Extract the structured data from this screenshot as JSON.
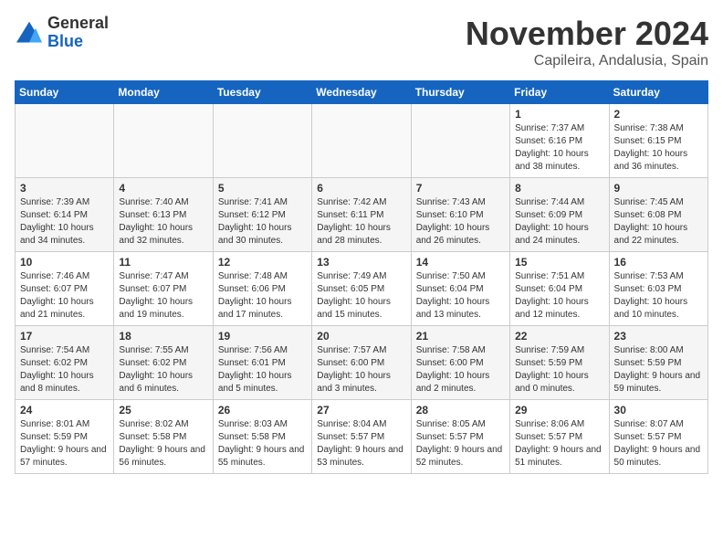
{
  "logo": {
    "general": "General",
    "blue": "Blue"
  },
  "title": "November 2024",
  "location": "Capileira, Andalusia, Spain",
  "days_of_week": [
    "Sunday",
    "Monday",
    "Tuesday",
    "Wednesday",
    "Thursday",
    "Friday",
    "Saturday"
  ],
  "weeks": [
    [
      {
        "day": "",
        "info": ""
      },
      {
        "day": "",
        "info": ""
      },
      {
        "day": "",
        "info": ""
      },
      {
        "day": "",
        "info": ""
      },
      {
        "day": "",
        "info": ""
      },
      {
        "day": "1",
        "info": "Sunrise: 7:37 AM\nSunset: 6:16 PM\nDaylight: 10 hours and 38 minutes."
      },
      {
        "day": "2",
        "info": "Sunrise: 7:38 AM\nSunset: 6:15 PM\nDaylight: 10 hours and 36 minutes."
      }
    ],
    [
      {
        "day": "3",
        "info": "Sunrise: 7:39 AM\nSunset: 6:14 PM\nDaylight: 10 hours and 34 minutes."
      },
      {
        "day": "4",
        "info": "Sunrise: 7:40 AM\nSunset: 6:13 PM\nDaylight: 10 hours and 32 minutes."
      },
      {
        "day": "5",
        "info": "Sunrise: 7:41 AM\nSunset: 6:12 PM\nDaylight: 10 hours and 30 minutes."
      },
      {
        "day": "6",
        "info": "Sunrise: 7:42 AM\nSunset: 6:11 PM\nDaylight: 10 hours and 28 minutes."
      },
      {
        "day": "7",
        "info": "Sunrise: 7:43 AM\nSunset: 6:10 PM\nDaylight: 10 hours and 26 minutes."
      },
      {
        "day": "8",
        "info": "Sunrise: 7:44 AM\nSunset: 6:09 PM\nDaylight: 10 hours and 24 minutes."
      },
      {
        "day": "9",
        "info": "Sunrise: 7:45 AM\nSunset: 6:08 PM\nDaylight: 10 hours and 22 minutes."
      }
    ],
    [
      {
        "day": "10",
        "info": "Sunrise: 7:46 AM\nSunset: 6:07 PM\nDaylight: 10 hours and 21 minutes."
      },
      {
        "day": "11",
        "info": "Sunrise: 7:47 AM\nSunset: 6:07 PM\nDaylight: 10 hours and 19 minutes."
      },
      {
        "day": "12",
        "info": "Sunrise: 7:48 AM\nSunset: 6:06 PM\nDaylight: 10 hours and 17 minutes."
      },
      {
        "day": "13",
        "info": "Sunrise: 7:49 AM\nSunset: 6:05 PM\nDaylight: 10 hours and 15 minutes."
      },
      {
        "day": "14",
        "info": "Sunrise: 7:50 AM\nSunset: 6:04 PM\nDaylight: 10 hours and 13 minutes."
      },
      {
        "day": "15",
        "info": "Sunrise: 7:51 AM\nSunset: 6:04 PM\nDaylight: 10 hours and 12 minutes."
      },
      {
        "day": "16",
        "info": "Sunrise: 7:53 AM\nSunset: 6:03 PM\nDaylight: 10 hours and 10 minutes."
      }
    ],
    [
      {
        "day": "17",
        "info": "Sunrise: 7:54 AM\nSunset: 6:02 PM\nDaylight: 10 hours and 8 minutes."
      },
      {
        "day": "18",
        "info": "Sunrise: 7:55 AM\nSunset: 6:02 PM\nDaylight: 10 hours and 6 minutes."
      },
      {
        "day": "19",
        "info": "Sunrise: 7:56 AM\nSunset: 6:01 PM\nDaylight: 10 hours and 5 minutes."
      },
      {
        "day": "20",
        "info": "Sunrise: 7:57 AM\nSunset: 6:00 PM\nDaylight: 10 hours and 3 minutes."
      },
      {
        "day": "21",
        "info": "Sunrise: 7:58 AM\nSunset: 6:00 PM\nDaylight: 10 hours and 2 minutes."
      },
      {
        "day": "22",
        "info": "Sunrise: 7:59 AM\nSunset: 5:59 PM\nDaylight: 10 hours and 0 minutes."
      },
      {
        "day": "23",
        "info": "Sunrise: 8:00 AM\nSunset: 5:59 PM\nDaylight: 9 hours and 59 minutes."
      }
    ],
    [
      {
        "day": "24",
        "info": "Sunrise: 8:01 AM\nSunset: 5:59 PM\nDaylight: 9 hours and 57 minutes."
      },
      {
        "day": "25",
        "info": "Sunrise: 8:02 AM\nSunset: 5:58 PM\nDaylight: 9 hours and 56 minutes."
      },
      {
        "day": "26",
        "info": "Sunrise: 8:03 AM\nSunset: 5:58 PM\nDaylight: 9 hours and 55 minutes."
      },
      {
        "day": "27",
        "info": "Sunrise: 8:04 AM\nSunset: 5:57 PM\nDaylight: 9 hours and 53 minutes."
      },
      {
        "day": "28",
        "info": "Sunrise: 8:05 AM\nSunset: 5:57 PM\nDaylight: 9 hours and 52 minutes."
      },
      {
        "day": "29",
        "info": "Sunrise: 8:06 AM\nSunset: 5:57 PM\nDaylight: 9 hours and 51 minutes."
      },
      {
        "day": "30",
        "info": "Sunrise: 8:07 AM\nSunset: 5:57 PM\nDaylight: 9 hours and 50 minutes."
      }
    ]
  ]
}
